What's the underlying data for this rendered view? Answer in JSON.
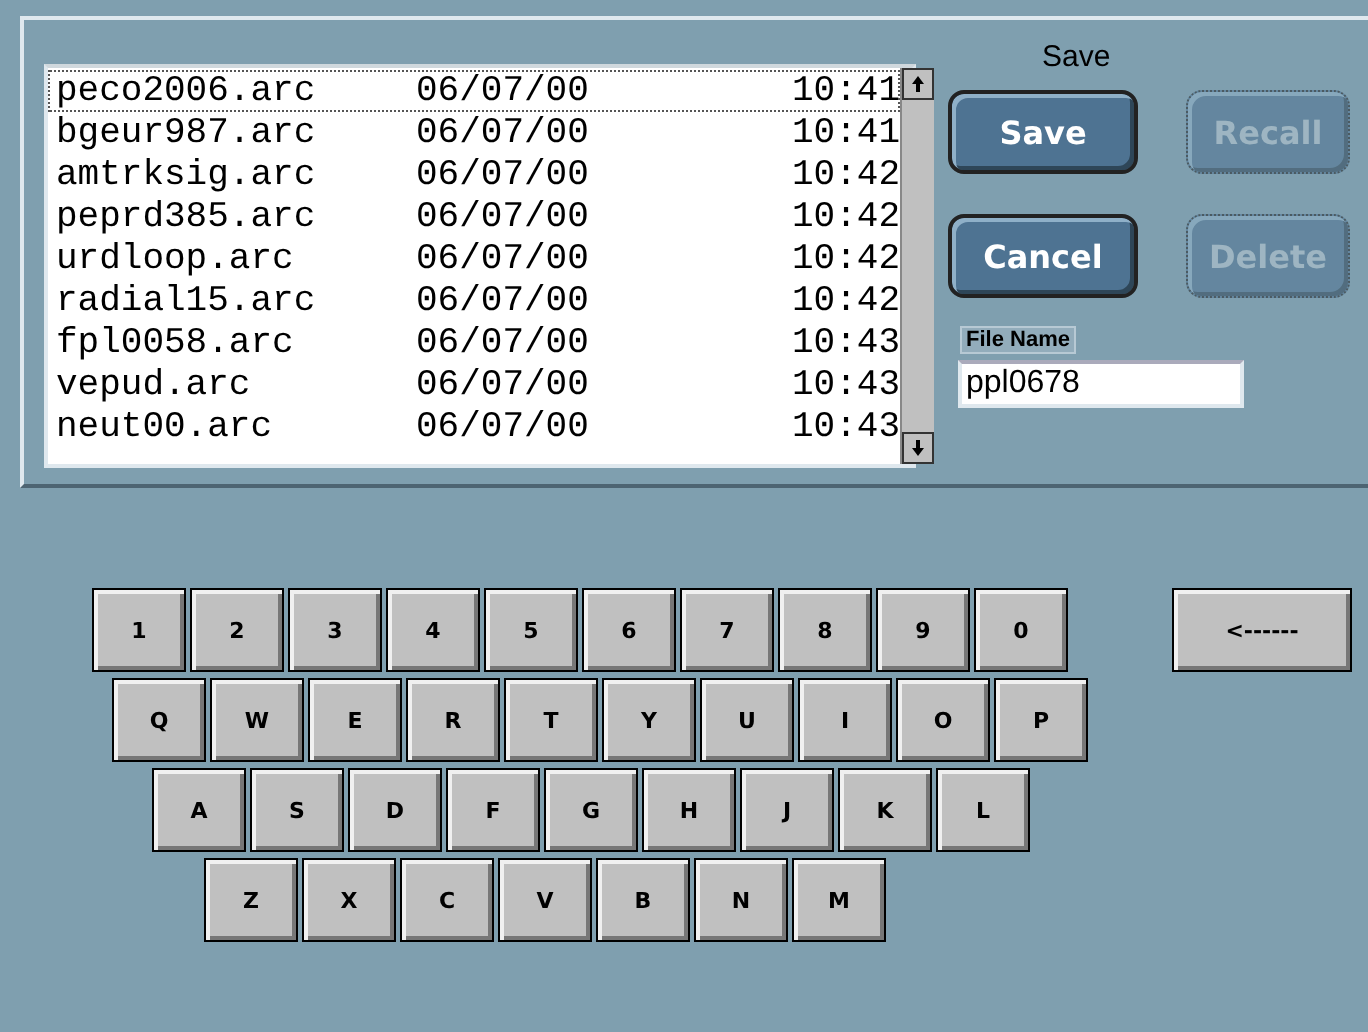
{
  "dialog_title": "Save",
  "files": [
    {
      "name": "peco2006.arc",
      "date": "06/07/00",
      "time": "10:41",
      "selected": true
    },
    {
      "name": "bgeur987.arc",
      "date": "06/07/00",
      "time": "10:41",
      "selected": false
    },
    {
      "name": "amtrksig.arc",
      "date": "06/07/00",
      "time": "10:42",
      "selected": false
    },
    {
      "name": "peprd385.arc",
      "date": "06/07/00",
      "time": "10:42",
      "selected": false
    },
    {
      "name": "urdloop.arc",
      "date": "06/07/00",
      "time": "10:42",
      "selected": false
    },
    {
      "name": "radial15.arc",
      "date": "06/07/00",
      "time": "10:42",
      "selected": false
    },
    {
      "name": "fpl0058.arc",
      "date": "06/07/00",
      "time": "10:43",
      "selected": false
    },
    {
      "name": "vepud.arc",
      "date": "06/07/00",
      "time": "10:43",
      "selected": false
    },
    {
      "name": "neut00.arc",
      "date": "06/07/00",
      "time": "10:43",
      "selected": false
    }
  ],
  "buttons": [
    {
      "label": "Save",
      "disabled": false
    },
    {
      "label": "Recall",
      "disabled": true
    },
    {
      "label": "Cancel",
      "disabled": false
    },
    {
      "label": "Delete",
      "disabled": true
    }
  ],
  "file_name": {
    "label": "File Name",
    "value": "ppl0678"
  },
  "keyboard": {
    "rows": [
      [
        "1",
        "2",
        "3",
        "4",
        "5",
        "6",
        "7",
        "8",
        "9",
        "0"
      ],
      [
        "Q",
        "W",
        "E",
        "R",
        "T",
        "Y",
        "U",
        "I",
        "O",
        "P"
      ],
      [
        "A",
        "S",
        "D",
        "F",
        "G",
        "H",
        "J",
        "K",
        "L"
      ],
      [
        "Z",
        "X",
        "C",
        "V",
        "B",
        "N",
        "M"
      ]
    ],
    "backspace": "<------"
  }
}
